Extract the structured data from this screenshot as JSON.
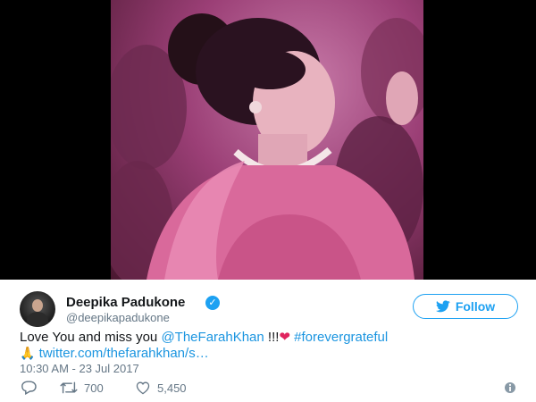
{
  "tweet": {
    "author_name": "Deepika Padukone",
    "handle": "@deepikapadukone",
    "follow_label": "Follow",
    "text_part1": "Love You and miss you ",
    "mention": "@TheFarahKhan",
    "text_part2": " !!!",
    "heart": "❤",
    "hashtag": " #forevergrateful",
    "emoji": "🙏",
    "link": "twitter.com/thefarahkhan/s…",
    "timestamp": "10:30 AM - 23 Jul 2017",
    "retweets": "700",
    "likes": "5,450"
  },
  "colors": {
    "accent": "#1da1f2",
    "link": "#1b95e0",
    "heart": "#e0245e",
    "muted": "#657786"
  },
  "icons": [
    "verified-badge-icon",
    "twitter-bird-icon",
    "reply-icon",
    "retweet-icon",
    "like-icon",
    "info-icon"
  ]
}
